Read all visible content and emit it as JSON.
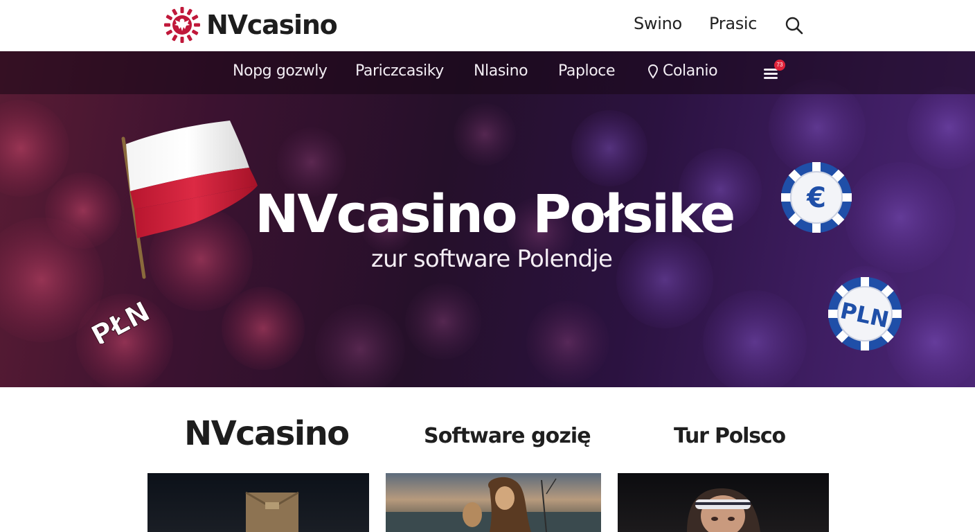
{
  "header": {
    "logo_text": "NVcasino",
    "links": [
      "Swino",
      "Prasic"
    ],
    "search_icon": "search-icon"
  },
  "subnav": {
    "items": [
      "Nopg gozwly",
      "Pariczcasiky",
      "Nlasino",
      "Paploce",
      "Colanio"
    ],
    "colanio_icon": "location-pin-icon",
    "menu_icon": "hamburger-menu-icon",
    "menu_badge": "73"
  },
  "hero": {
    "title": "NVcasino Połsike",
    "subtitle": "zur software Polendje",
    "flag_label": "PŁN",
    "chips": [
      {
        "label": "€",
        "icon": "euro-chip-icon"
      },
      {
        "label": "PLN",
        "icon": "pln-chip-icon"
      }
    ]
  },
  "section": {
    "headings": [
      "NVcasino",
      "Software gozię",
      "Tur Polsco"
    ]
  },
  "colors": {
    "brand_red": "#c0183a",
    "chip_blue": "#1f4fa8",
    "hero_dark": "#25102a",
    "hero_purple": "#4b2676"
  }
}
